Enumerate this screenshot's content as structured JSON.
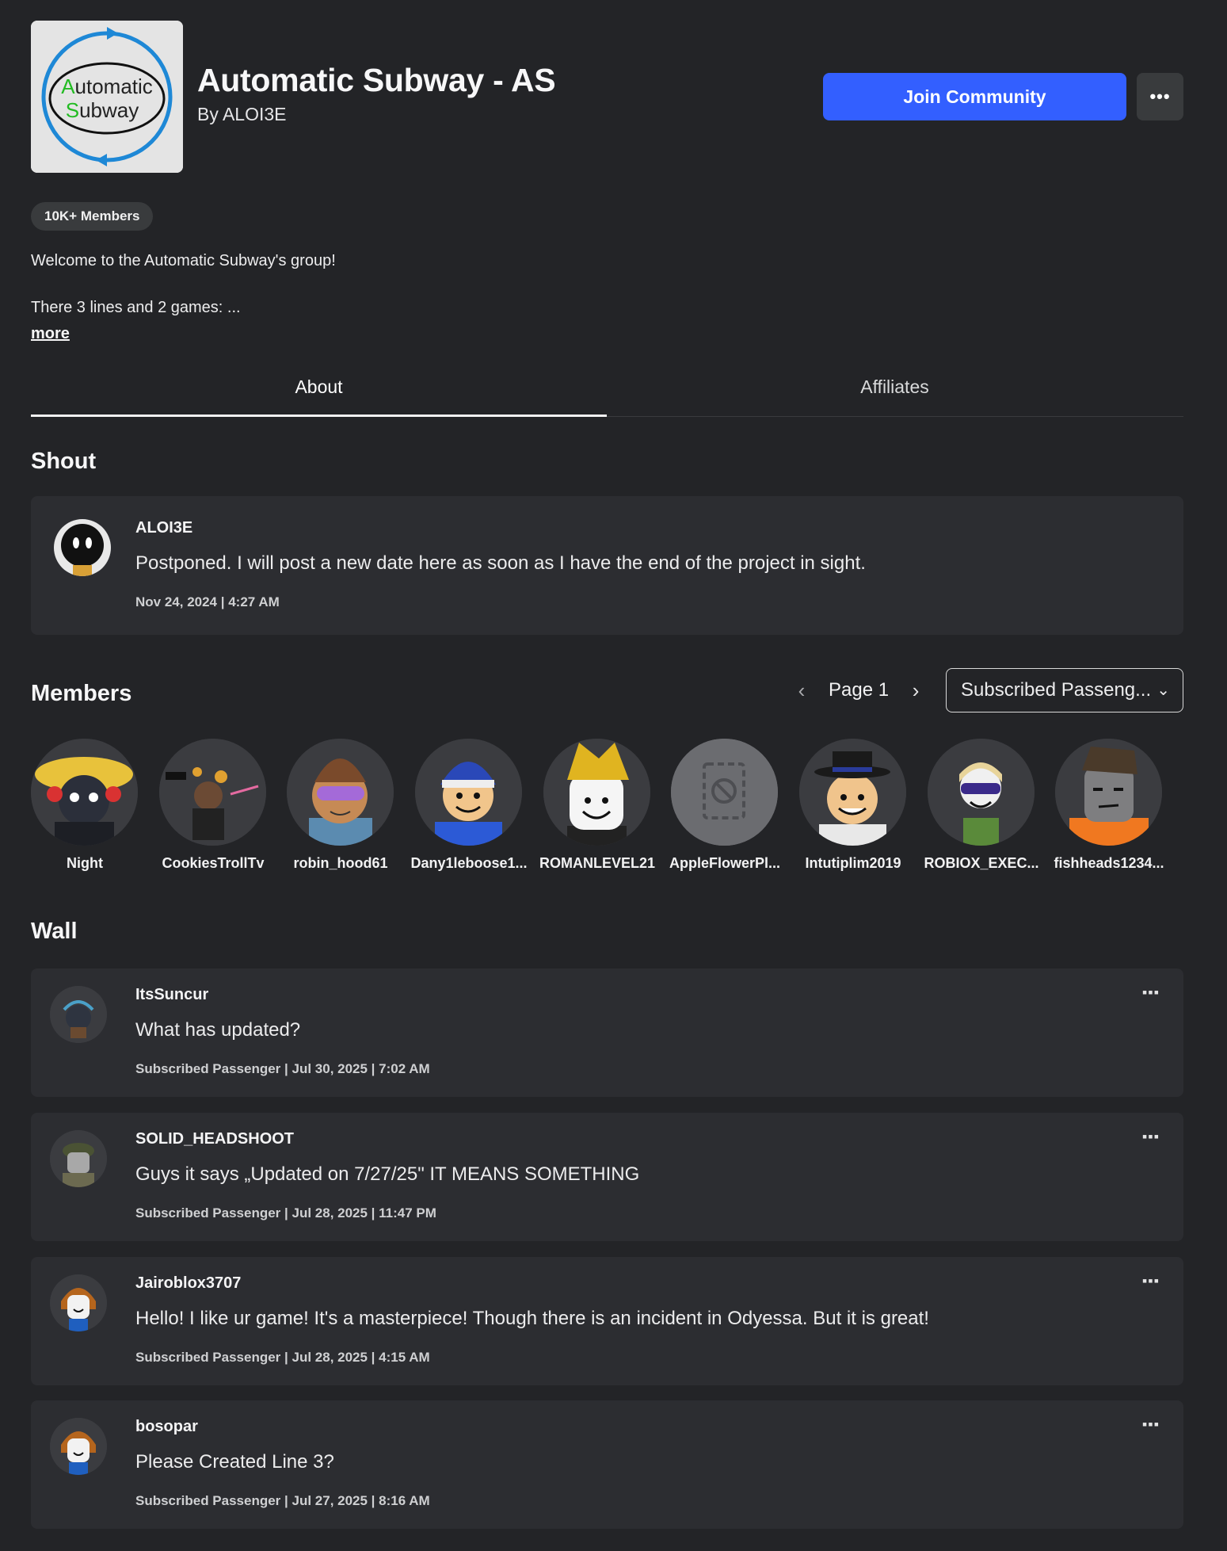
{
  "group": {
    "logo_text_line1": "Automatic",
    "logo_text_line2": "Subway",
    "name": "Automatic Subway - AS",
    "byline": "By ALOI3E",
    "join_label": "Join Community",
    "more_label": "•••",
    "members_badge": "10K+ Members",
    "description_line1": "Welcome to the Automatic Subway's group!",
    "description_line2": "There 3 lines and 2 games: ...",
    "more_link": "more"
  },
  "tabs": [
    {
      "label": "About",
      "active": true
    },
    {
      "label": "Affiliates",
      "active": false
    }
  ],
  "shout": {
    "section_title": "Shout",
    "author": "ALOI3E",
    "body": "Postponed. I will post a new date here as soon as I have the end of the project in sight.",
    "meta": "Nov 24, 2024 | 4:27 AM"
  },
  "members_section": {
    "title": "Members",
    "page_label": "Page 1",
    "role_filter": "Subscribed Passeng...",
    "members": [
      {
        "name": "Night",
        "icon": "avatar-night"
      },
      {
        "name": "CookiesTrollTv",
        "icon": "avatar-cookies"
      },
      {
        "name": "robin_hood61",
        "icon": "avatar-robin"
      },
      {
        "name": "Dany1leboose1...",
        "icon": "avatar-dany"
      },
      {
        "name": "ROMANLEVEL21",
        "icon": "avatar-roman"
      },
      {
        "name": "AppleFlowerPl...",
        "icon": "avatar-unavailable"
      },
      {
        "name": "Intutiplim2019",
        "icon": "avatar-intutiplim"
      },
      {
        "name": "ROBIOX_EXEC...",
        "icon": "avatar-robiox"
      },
      {
        "name": "fishheads1234...",
        "icon": "avatar-fishheads"
      }
    ]
  },
  "wall": {
    "title": "Wall",
    "posts": [
      {
        "author": "ItsSuncur",
        "body": "What has updated?",
        "meta": "Subscribed Passenger | Jul 30, 2025 | 7:02 AM"
      },
      {
        "author": "SOLID_HEADSHOOT",
        "body": "Guys it says „Updated on 7/27/25\" IT MEANS SOMETHING",
        "meta": "Subscribed Passenger | Jul 28, 2025 | 11:47 PM"
      },
      {
        "author": "Jairoblox3707",
        "body": "Hello! I like ur game! It's a masterpiece! Though there is an incident in Odyessa. But it is great!",
        "meta": "Subscribed Passenger | Jul 28, 2025 | 4:15 AM"
      },
      {
        "author": "bosopar",
        "body": "Please Created Line 3?",
        "meta": "Subscribed Passenger | Jul 27, 2025 | 8:16 AM"
      }
    ],
    "post_menu_label": "▪▪▪"
  },
  "colors": {
    "background": "#232427",
    "card": "#2c2d31",
    "accent": "#335fff"
  }
}
